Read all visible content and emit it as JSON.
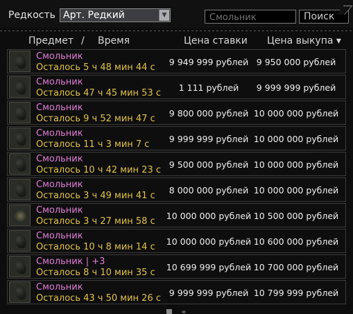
{
  "filter": {
    "rarity_label": "Редкость",
    "rarity_value": "Арт. Редкий",
    "search_placeholder": "Смольник",
    "search_button": "Поиск"
  },
  "columns": {
    "item": "Предмет",
    "separator": "/",
    "time": "Время",
    "bid": "Цена ставки",
    "buyout": "Цена выкупа ▾"
  },
  "rows": [
    {
      "icon": "resin-artifact-icon",
      "name": "Смольник",
      "time": "Осталось 5 ч 48 мин 44 с",
      "bid": "9 949 999 рублей",
      "buyout": "9 950 000 рублей"
    },
    {
      "icon": "resin-artifact-icon",
      "name": "Смольник",
      "time": "Осталось 47 ч 45 мин 53 с",
      "bid": "1 111 рублей",
      "buyout": "9 999 999 рублей"
    },
    {
      "icon": "resin-artifact-icon",
      "name": "Смольник",
      "time": "Осталось 9 ч 52 мин 47 с",
      "bid": "9 800 000 рублей",
      "buyout": "10 000 000 рублей"
    },
    {
      "icon": "resin-artifact-icon",
      "name": "Смольник",
      "time": "Осталось 11 ч 3 мин 7 с",
      "bid": "9 999 999 рублей",
      "buyout": "10 000 000 рублей"
    },
    {
      "icon": "resin-artifact-icon",
      "name": "Смольник",
      "time": "Осталось 10 ч 42 мин 23 с",
      "bid": "9 500 000 рублей",
      "buyout": "10 000 000 рублей"
    },
    {
      "icon": "resin-artifact-icon",
      "name": "Смольник",
      "time": "Осталось 3 ч 49 мин 41 с",
      "bid": "8 000 000 рублей",
      "buyout": "10 000 000 рублей"
    },
    {
      "icon": "resin-artifact-alt-icon",
      "name": "Смольник",
      "time": "Осталось 3 ч 27 мин 58 с",
      "bid": "10 000 000 рублей",
      "buyout": "10 500 000 рублей"
    },
    {
      "icon": "resin-artifact-icon",
      "name": "Смольник",
      "time": "Осталось 10 ч 8 мин 14 с",
      "bid": "10 000 000 рублей",
      "buyout": "10 600 000 рублей"
    },
    {
      "icon": "resin-artifact-icon",
      "name": "Смольник | +3",
      "time": "Осталось 8 ч 10 мин 35 с",
      "bid": "10 699 999 рублей",
      "buyout": "10 700 000 рублей"
    },
    {
      "icon": "resin-artifact-icon",
      "name": "Смольник",
      "time": "Осталось 43 ч 50 мин 26 с",
      "bid": "9 999 999 рублей",
      "buyout": "10 799 999 рублей"
    }
  ],
  "colors": {
    "item_name": "#e17ed8",
    "time_left": "#e1c24a",
    "background": "#0d0d0d"
  }
}
